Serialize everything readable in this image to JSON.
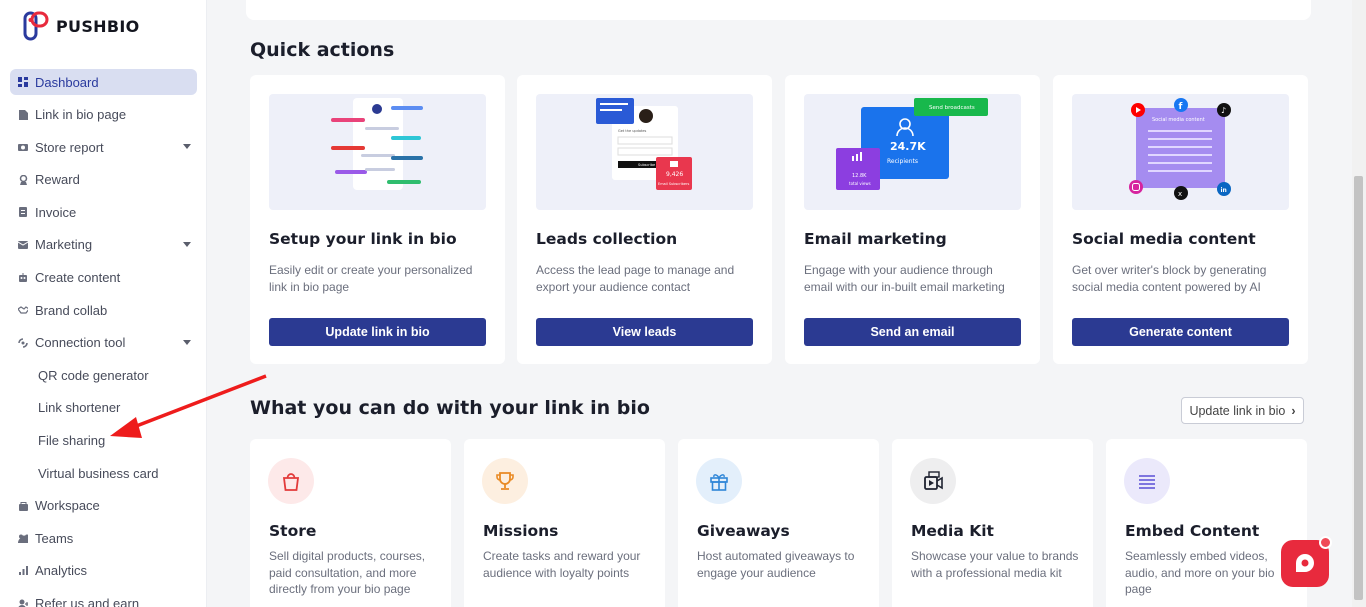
{
  "brand": {
    "name": "PUSHBIO"
  },
  "sidebar": {
    "items": [
      {
        "label": "Dashboard",
        "icon": "dashboard-icon"
      },
      {
        "label": "Link in bio page",
        "icon": "page-icon"
      },
      {
        "label": "Store report",
        "icon": "store-icon"
      },
      {
        "label": "Reward",
        "icon": "reward-icon"
      },
      {
        "label": "Invoice",
        "icon": "invoice-icon"
      },
      {
        "label": "Marketing",
        "icon": "mail-icon"
      },
      {
        "label": "Create content",
        "icon": "robot-icon"
      },
      {
        "label": "Brand collab",
        "icon": "handshake-icon"
      },
      {
        "label": "Connection tool",
        "icon": "connection-icon"
      }
    ],
    "sub_items": [
      "QR code generator",
      "Link shortener",
      "File sharing",
      "Virtual business card"
    ],
    "bottom_items": [
      {
        "label": "Workspace",
        "icon": "workspace-icon"
      },
      {
        "label": "Teams",
        "icon": "teams-icon"
      },
      {
        "label": "Analytics",
        "icon": "analytics-icon"
      },
      {
        "label": "Refer us and earn",
        "icon": "refer-icon"
      }
    ]
  },
  "quick_actions": {
    "heading": "Quick actions",
    "cards": [
      {
        "title": "Setup your link in bio",
        "desc": "Easily edit or create your personalized link in bio page",
        "button": "Update link in bio"
      },
      {
        "title": "Leads collection",
        "desc": "Access the lead page to manage and export your audience contact",
        "button": "View leads"
      },
      {
        "title": "Email marketing",
        "desc": "Engage with your audience through email with our in-built email marketing",
        "button": "Send an email"
      },
      {
        "title": "Social media content",
        "desc": "Get over writer's block by generating social media content powered by AI",
        "button": "Generate content"
      }
    ],
    "leads_img": {
      "name": "Get the updates",
      "count": "9,426",
      "count_label": "Email Subscribers",
      "subscribe": "Subscribe"
    },
    "email_img": {
      "broadcast": "Send broadcasts",
      "value": "24.7K",
      "label": "Recipients",
      "small_value": "12.8K",
      "small_label": "total views"
    },
    "social_img": {
      "label": "Social media content"
    }
  },
  "features": {
    "heading": "What you can do with your link in bio",
    "update_button": "Update link in bio",
    "cards": [
      {
        "title": "Store",
        "desc": "Sell digital products, courses, paid consultation, and more directly from your bio page",
        "icon": "shopping-bag-icon",
        "color": "#e23a3a",
        "bg": "#fde9e9"
      },
      {
        "title": "Missions",
        "desc": "Create tasks and reward your audience with loyalty points",
        "icon": "trophy-icon",
        "color": "#e98a24",
        "bg": "#fdefe0"
      },
      {
        "title": "Giveaways",
        "desc": "Host automated giveaways to engage your audience",
        "icon": "gift-icon",
        "color": "#2f86d8",
        "bg": "#e3effb"
      },
      {
        "title": "Media Kit",
        "desc": "Showcase your value to brands with a professional media kit",
        "icon": "media-kit-icon",
        "color": "#1e2230",
        "bg": "#eeeeef"
      },
      {
        "title": "Embed Content",
        "desc": "Seamlessly embed videos, audio, and more on your bio page",
        "icon": "list-icon",
        "color": "#5b4fd6",
        "bg": "#ebe9fb"
      }
    ]
  },
  "colors": {
    "primary": "#2b3a92",
    "accent": "#e82a3d",
    "active_bg": "#d9def1"
  }
}
